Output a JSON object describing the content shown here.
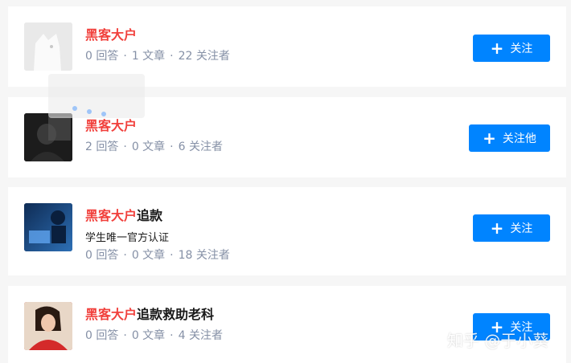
{
  "users": [
    {
      "name_highlight": "黑客大户",
      "name_rest": "",
      "bio": "",
      "answers": "0 回答",
      "articles": "1 文章",
      "followers": "22 关注者",
      "button_label": "关注",
      "avatar_icon": "default-dog-avatar"
    },
    {
      "name_highlight": "黑客大户",
      "name_rest": "",
      "bio": "",
      "answers": "2 回答",
      "articles": "0 文章",
      "followers": "6 关注者",
      "button_label": "关注他",
      "avatar_icon": "person-dark-photo-avatar"
    },
    {
      "name_highlight": "黑客大户",
      "name_rest": "追款",
      "bio": "学生唯一官方认证",
      "answers": "0 回答",
      "articles": "0 文章",
      "followers": "18 关注者",
      "button_label": "关注",
      "avatar_icon": "blue-computer-photo-avatar"
    },
    {
      "name_highlight": "黑客大户",
      "name_rest": "追款救助老科",
      "bio": "",
      "answers": "0 回答",
      "articles": "0 文章",
      "followers": "4 关注者",
      "button_label": "关注",
      "avatar_icon": "woman-red-photo-avatar"
    }
  ],
  "separator": "·",
  "watermark": "知乎 @于小葵",
  "colors": {
    "accent": "#0084ff",
    "highlight": "#f1403c",
    "meta": "#8590a6"
  }
}
